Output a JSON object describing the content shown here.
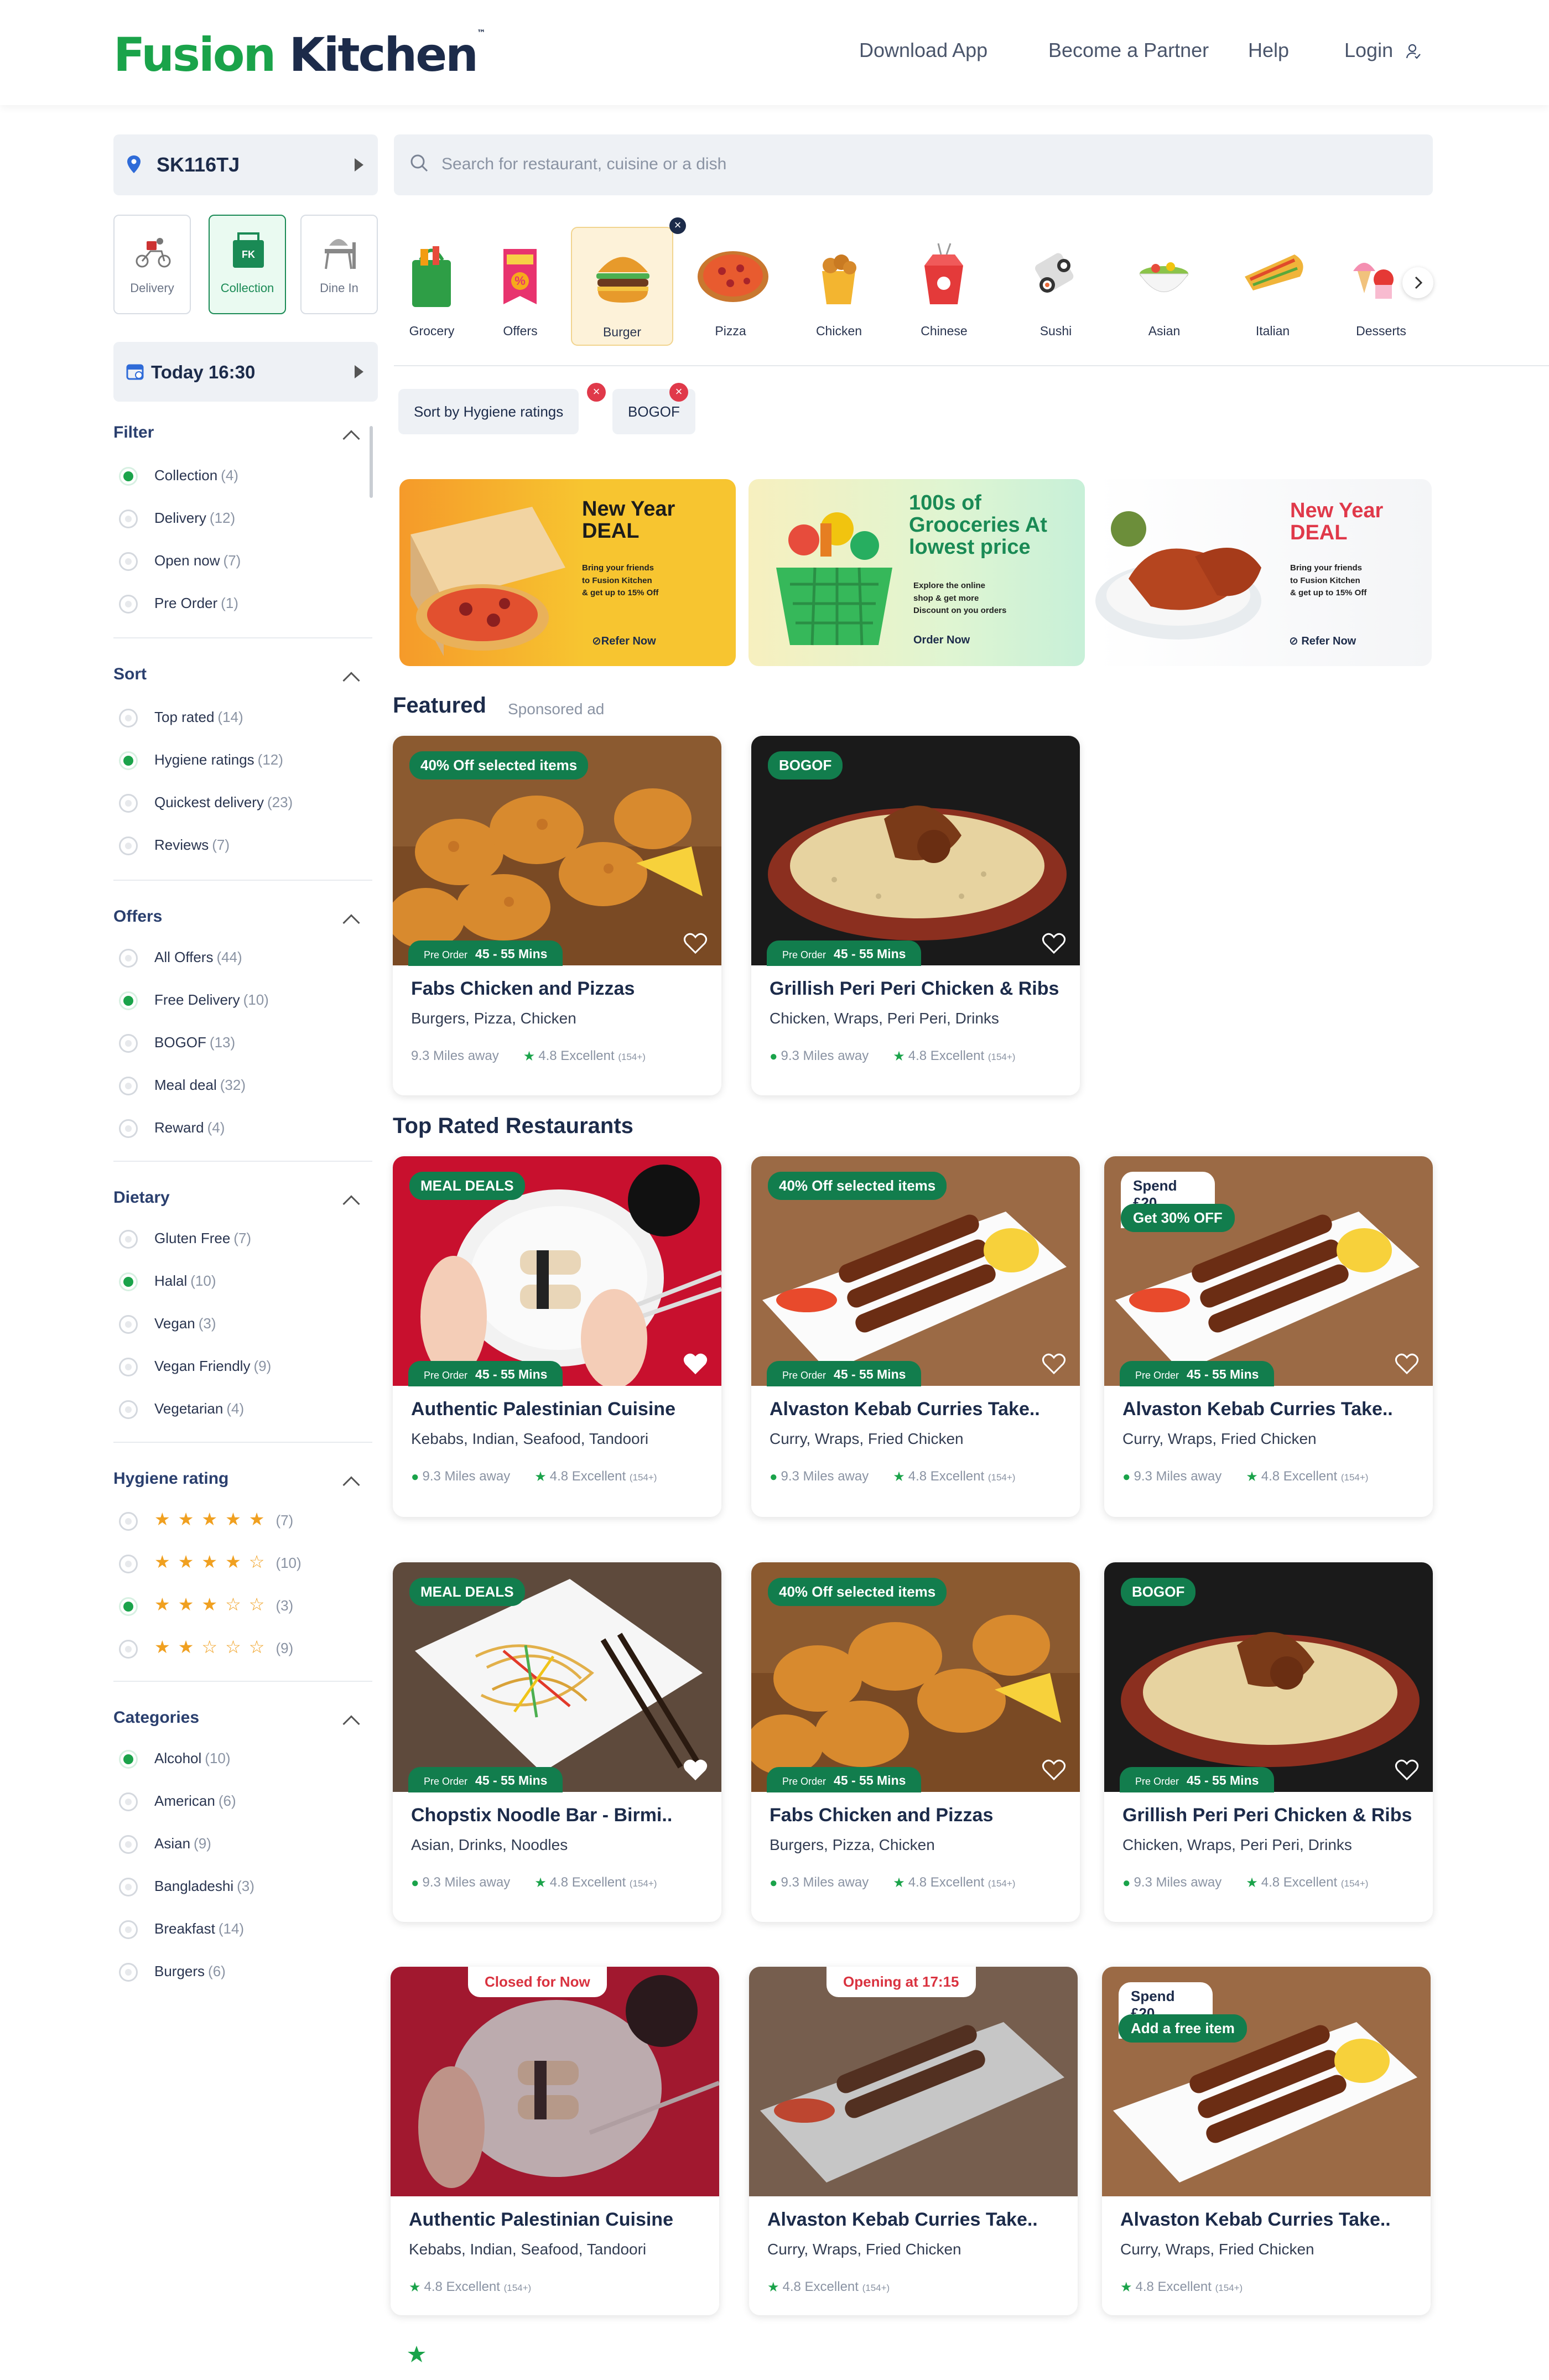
{
  "header": {
    "logo_part1": "Fusion",
    "logo_part2": "Kitchen",
    "logo_tm": "™",
    "nav": [
      "Download App",
      "Become a Partner",
      "Help",
      "Login"
    ]
  },
  "location": {
    "postcode": "SK116TJ"
  },
  "modes": [
    {
      "label": "Delivery",
      "active": false
    },
    {
      "label": "Collection",
      "active": true
    },
    {
      "label": "Dine In",
      "active": false
    }
  ],
  "time": {
    "label": "Today 16:30"
  },
  "search": {
    "placeholder": "Search for restaurant, cuisine or a dish"
  },
  "categories": [
    "Grocery",
    "Offers",
    "Burger",
    "Pizza",
    "Chicken",
    "Chinese",
    "Sushi",
    "Asian",
    "Italian",
    "Desserts"
  ],
  "active_category": "Burger",
  "chips": [
    "Sort by Hygiene ratings",
    "BOGOF"
  ],
  "filters": {
    "filter": {
      "title": "Filter",
      "options": [
        {
          "label": "Collection",
          "count": "(4)",
          "on": true
        },
        {
          "label": "Delivery",
          "count": "(12)",
          "on": false
        },
        {
          "label": "Open now",
          "count": "(7)",
          "on": false
        },
        {
          "label": "Pre Order",
          "count": "(1)",
          "on": false
        }
      ]
    },
    "sort": {
      "title": "Sort",
      "options": [
        {
          "label": "Top rated",
          "count": "(14)",
          "on": false
        },
        {
          "label": "Hygiene ratings",
          "count": "(12)",
          "on": true
        },
        {
          "label": "Quickest delivery",
          "count": "(23)",
          "on": false
        },
        {
          "label": "Reviews",
          "count": "(7)",
          "on": false
        }
      ]
    },
    "offers": {
      "title": "Offers",
      "options": [
        {
          "label": "All Offers",
          "count": "(44)",
          "on": false
        },
        {
          "label": "Free Delivery",
          "count": "(10)",
          "on": true
        },
        {
          "label": "BOGOF",
          "count": "(13)",
          "on": false
        },
        {
          "label": "Meal deal",
          "count": "(32)",
          "on": false
        },
        {
          "label": "Reward",
          "count": "(4)",
          "on": false
        }
      ]
    },
    "dietary": {
      "title": "Dietary",
      "options": [
        {
          "label": "Gluten Free",
          "count": "(7)",
          "on": false
        },
        {
          "label": "Halal",
          "count": "(10)",
          "on": true
        },
        {
          "label": "Vegan",
          "count": "(3)",
          "on": false
        },
        {
          "label": "Vegan Friendly",
          "count": "(9)",
          "on": false
        },
        {
          "label": "Vegetarian",
          "count": "(4)",
          "on": false
        }
      ]
    },
    "hygiene": {
      "title": "Hygiene rating",
      "options": [
        {
          "stars": 5,
          "count": "(7)",
          "on": false
        },
        {
          "stars": 4,
          "count": "(10)",
          "on": false
        },
        {
          "stars": 3,
          "count": "(3)",
          "on": true
        },
        {
          "stars": 2,
          "count": "(9)",
          "on": false
        }
      ]
    },
    "categories": {
      "title": "Categories",
      "options": [
        {
          "label": "Alcohol",
          "count": "(10)",
          "on": true
        },
        {
          "label": "American",
          "count": "(6)",
          "on": false
        },
        {
          "label": "Asian",
          "count": "(9)",
          "on": false
        },
        {
          "label": "Bangladeshi",
          "count": "(3)",
          "on": false
        },
        {
          "label": "Breakfast",
          "count": "(14)",
          "on": false
        },
        {
          "label": "Burgers",
          "count": "(6)",
          "on": false
        }
      ]
    }
  },
  "banners": [
    {
      "title1": "New Year",
      "title2": "DEAL",
      "body": [
        "Bring your friends",
        "to Fusion Kitchen",
        "&  get up to 15% Off"
      ],
      "cta": "Refer Now"
    },
    {
      "title1": "100s of",
      "title2": "Grooceries At",
      "title3": "lowest price",
      "body": [
        "Explore the online",
        "shop & get more",
        "Discount on you orders"
      ],
      "cta": "Order Now"
    },
    {
      "title1": "New Year",
      "title2": "DEAL",
      "body": [
        "Bring your friends",
        "to Fusion Kitchen",
        "&  get up to 15% Off"
      ],
      "cta": "Refer Now"
    }
  ],
  "featured": {
    "title": "Featured",
    "sub": "Sponsored ad"
  },
  "top_rated": {
    "title": "Top Rated Restaurants"
  },
  "rest_common": {
    "pre_order": "Pre Order",
    "time": "45 - 55 Mins",
    "distance": "9.3 Miles away",
    "rating": "4.8 Excellent",
    "reviews": "(154+)"
  },
  "restaurants": [
    {
      "name": "Fabs Chicken and Pizzas",
      "cuisine": "Burgers, Pizza, Chicken",
      "badge": "40% Off selected items"
    },
    {
      "name": "Grillish Peri Peri Chicken & Ribs",
      "cuisine": "Chicken, Wraps, Peri Peri, Drinks",
      "badge": "BOGOF"
    },
    {
      "name": "Authentic Palestinian Cuisine",
      "cuisine": "Kebabs, Indian, Seafood, Tandoori",
      "badge": "MEAL DEALS"
    },
    {
      "name": "Alvaston Kebab Curries Take..",
      "cuisine": "Curry, Wraps, Fried Chicken",
      "badge": "40% Off selected items"
    },
    {
      "name": "Alvaston Kebab Curries Take..",
      "cuisine": "Curry, Wraps, Fried Chicken",
      "badge_top": "Spend £20",
      "badge": "Get 30% OFF"
    },
    {
      "name": "Chopstix Noodle Bar - Birmi..",
      "cuisine": "Asian, Drinks, Noodles",
      "badge": "MEAL DEALS"
    },
    {
      "name": "Fabs Chicken and Pizzas",
      "cuisine": "Burgers, Pizza, Chicken",
      "badge": "40% Off selected items"
    },
    {
      "name": "Grillish Peri Peri Chicken & Ribs",
      "cuisine": "Chicken, Wraps, Peri Peri, Drinks",
      "badge": "BOGOF"
    },
    {
      "name": "Authentic Palestinian Cuisine",
      "cuisine": "Kebabs, Indian, Seafood, Tandoori",
      "status": "Closed for Now"
    },
    {
      "name": "Alvaston Kebab Curries Take..",
      "cuisine": "Curry, Wraps, Fried Chicken",
      "status": "Opening at 17:15"
    },
    {
      "name": "Alvaston Kebab Curries Take..",
      "cuisine": "Curry, Wraps, Fried Chicken",
      "badge_top": "Spend £20",
      "badge": "Add a free item"
    }
  ],
  "colors": {
    "brand_green": "#1aa34a",
    "dark_green": "#127d4d",
    "navy": "#1c2b4a",
    "red": "#d9323f"
  }
}
